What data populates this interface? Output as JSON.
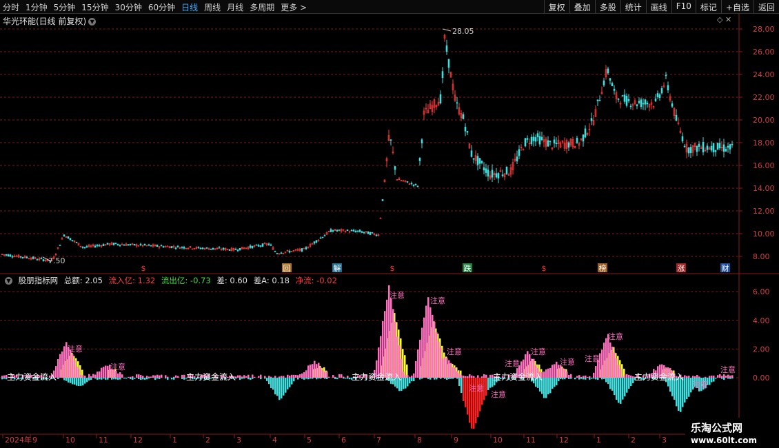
{
  "toolbar": {
    "periods": [
      "分时",
      "1分钟",
      "5分钟",
      "15分钟",
      "30分钟",
      "60分钟",
      "日线",
      "周线",
      "月线",
      "多周期",
      "更多 >"
    ],
    "active_period": "日线",
    "buttons": [
      "复权",
      "叠加",
      "多股",
      "统计",
      "画线",
      "F10",
      "标记",
      "+自选",
      "返回"
    ]
  },
  "stock": {
    "title": "华光环能(日线 前复权)",
    "high_label": "28.05",
    "low_label": "7.50"
  },
  "price_axis": [
    "28.00",
    "26.00",
    "24.00",
    "22.00",
    "20.00",
    "18.00",
    "16.00",
    "14.00",
    "12.00",
    "10.00",
    "8.00"
  ],
  "markers": [
    {
      "text": "$",
      "color": "#ff3333",
      "bg": ""
    },
    {
      "text": "回",
      "color": "#ffffff",
      "bg": "#b07020"
    },
    {
      "text": "解",
      "color": "#ffffff",
      "bg": "#207090"
    },
    {
      "text": "$",
      "color": "#ff3333",
      "bg": ""
    },
    {
      "text": "跌",
      "color": "#ffffff",
      "bg": "#208040"
    },
    {
      "text": "$",
      "color": "#ff3333",
      "bg": ""
    },
    {
      "text": "榜",
      "color": "#ffffff",
      "bg": "#a06020"
    },
    {
      "text": "涨",
      "color": "#ffffff",
      "bg": "#a02020"
    },
    {
      "text": "财",
      "color": "#ffffff",
      "bg": "#2050a0"
    }
  ],
  "indicator": {
    "name": "股朋指标网",
    "total": "总额: 2.05",
    "inflow": "流入亿: 1.32",
    "outflow": "流出亿: -0.73",
    "diff": "差: 0.60",
    "diffA": "差A: 0.18",
    "net": "净流: -0.02",
    "axis": [
      "6.00",
      "4.00",
      "2.00",
      "0.00"
    ],
    "note_label": "注意",
    "band_text": "主力资金流入"
  },
  "date_axis": [
    "2024年",
    "9",
    "10",
    "11",
    "12",
    "1",
    "2",
    "3",
    "4",
    "5",
    "6",
    "7",
    "8",
    "9",
    "10",
    "11",
    "12",
    "1",
    "2",
    "3"
  ],
  "colors": {
    "up": "#ff3b3b",
    "down": "#40e0e0",
    "magenta": "#ff70c0",
    "yellow": "#ffff30",
    "grid": "#7a1a1a"
  },
  "watermark": {
    "line1": "乐淘公式网",
    "line2": "www.60lt.com"
  }
}
